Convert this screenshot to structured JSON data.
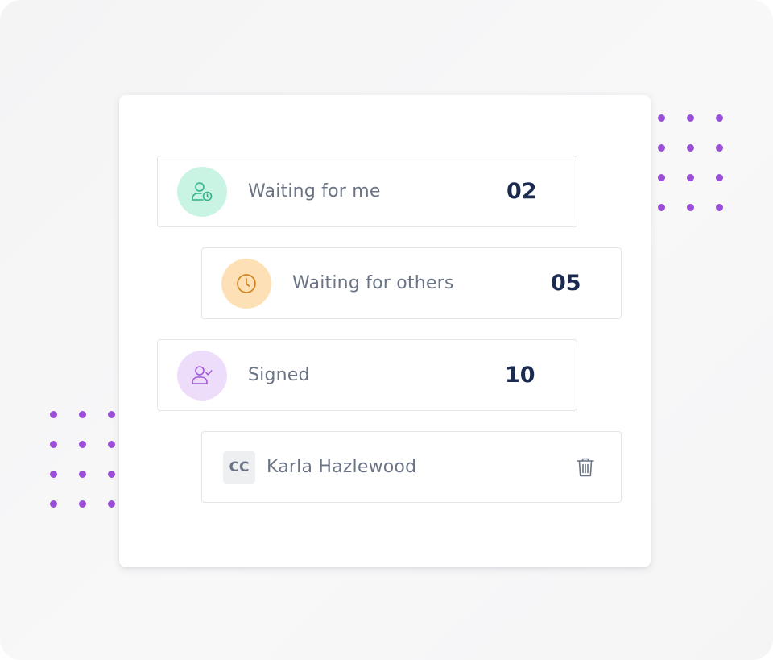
{
  "rows": [
    {
      "label": "Waiting for me",
      "count": "02",
      "icon": "user-clock-icon",
      "badge_color": "#c9f3e3",
      "icon_color": "#2fb38a"
    },
    {
      "label": "Waiting for others",
      "count": "05",
      "icon": "clock-icon",
      "badge_color": "#fde0b6",
      "icon_color": "#d1861f"
    },
    {
      "label": "Signed",
      "count": "10",
      "icon": "user-check-icon",
      "badge_color": "#eedcfb",
      "icon_color": "#a05ad8"
    }
  ],
  "recipient": {
    "tag": "CC",
    "name": "Karla Hazlewood",
    "action_icon": "trash-icon"
  },
  "colors": {
    "accent_dots": "#9b4fd9",
    "count_text": "#1a2b4f",
    "label_text": "#6b7485"
  }
}
